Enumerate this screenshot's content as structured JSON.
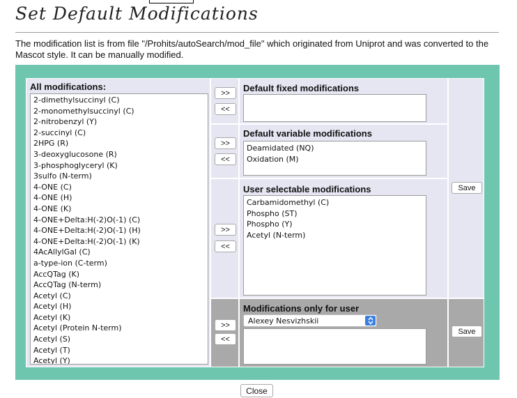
{
  "page": {
    "title": "Set Default Modifications",
    "description": "The modification list is from file \"/Prohits/autoSearch/mod_file\" which originated from Uniprot and was converted to the Mascot style. It can be manually modified."
  },
  "all_modifications": {
    "title": "All modifications:",
    "items": [
      "2-dimethylsuccinyl (C)",
      "2-monomethylsuccinyl (C)",
      "2-nitrobenzyl (Y)",
      "2-succinyl (C)",
      "2HPG (R)",
      "3-deoxyglucosone (R)",
      "3-phosphoglyceryl (K)",
      "3sulfo (N-term)",
      "4-ONE (C)",
      "4-ONE (H)",
      "4-ONE (K)",
      "4-ONE+Delta:H(-2)O(-1) (C)",
      "4-ONE+Delta:H(-2)O(-1) (H)",
      "4-ONE+Delta:H(-2)O(-1) (K)",
      "4AcAllylGal (C)",
      "a-type-ion (C-term)",
      "AccQTag (K)",
      "AccQTag (N-term)",
      "Acetyl (C)",
      "Acetyl (H)",
      "Acetyl (K)",
      "Acetyl (Protein N-term)",
      "Acetyl (S)",
      "Acetyl (T)",
      "Acetyl (Y)"
    ]
  },
  "buttons": {
    "add": ">>",
    "remove": "<<",
    "save": "Save",
    "close": "Close"
  },
  "fixed": {
    "title": "Default fixed modifications",
    "items": []
  },
  "variable": {
    "title": "Default variable modifications",
    "items": [
      "Deamidated (NQ)",
      "Oxidation (M)"
    ]
  },
  "selectable": {
    "title": "User selectable modifications",
    "items": [
      "Carbamidomethyl (C)",
      "Phospho (ST)",
      "Phospho (Y)",
      "Acetyl (N-term)"
    ]
  },
  "user_only": {
    "title": "Modifications only for user",
    "selected_user": "Alexey Nesvizhskii",
    "items": []
  },
  "colors": {
    "outer_background": "#6ec6ae",
    "panel_light": "#e5e6f2",
    "panel_dark": "#a9a9a9",
    "select_arrow": "#3a7fe0"
  }
}
